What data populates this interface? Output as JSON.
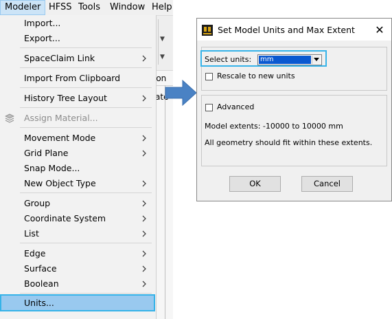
{
  "menubar": {
    "items": [
      {
        "label": "Modeler",
        "active": true
      },
      {
        "label": "HFSS"
      },
      {
        "label": "Tools"
      },
      {
        "label": "Window"
      },
      {
        "label": "Help"
      }
    ]
  },
  "background_app": {
    "panel_fragment": "ion",
    "panel_fragment2": "ate"
  },
  "menu": {
    "import_label": "Import...",
    "export_label": "Export...",
    "spaceclaim_label": "SpaceClaim Link",
    "import_clipboard_label": "Import From Clipboard",
    "history_tree_label": "History Tree Layout",
    "assign_material_label": "Assign Material...",
    "movement_mode_label": "Movement Mode",
    "grid_plane_label": "Grid Plane",
    "snap_mode_label": "Snap Mode...",
    "new_object_type_label": "New Object Type",
    "group_label": "Group",
    "coordinate_system_label": "Coordinate System",
    "list_label": "List",
    "edge_label": "Edge",
    "surface_label": "Surface",
    "boolean_label": "Boolean",
    "units_label": "Units..."
  },
  "dialog": {
    "title": "Set Model Units and Max Extent",
    "close_glyph": "✕",
    "select_units_label": "Select units:",
    "selected_unit": "mm",
    "rescale_label": "Rescale to new units",
    "rescale_checked": false,
    "advanced_label": "Advanced",
    "advanced_checked": false,
    "extents_text": "Model extents: -10000 to 10000 mm",
    "fit_text": "All geometry should fit within these extents.",
    "ok_label": "OK",
    "cancel_label": "Cancel"
  },
  "colors": {
    "highlight": "#99c9ef",
    "focus_border": "#36b3e8",
    "arrow": "#4a82c4",
    "selection": "#0a58d0"
  }
}
